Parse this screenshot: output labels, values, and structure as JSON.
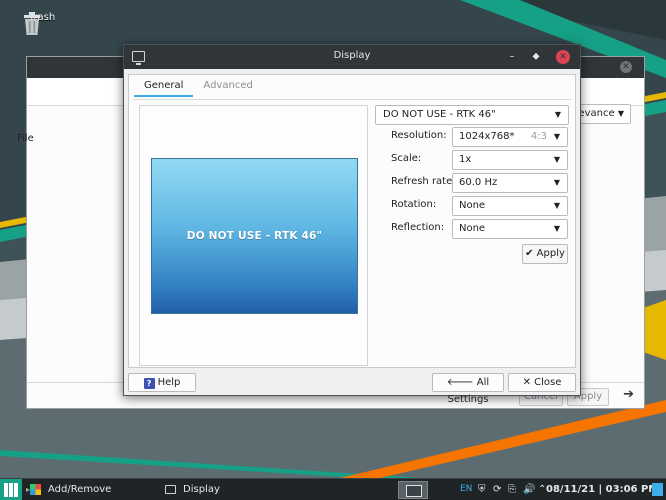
{
  "desktop": {
    "trash_label": "Trash",
    "colors": {
      "teal": "#16a085",
      "orange": "#f67400",
      "yellow": "#e6b800",
      "background": "#2b3a3f"
    }
  },
  "background_window": {
    "side_label": "File",
    "sort": {
      "value": "Relevance",
      "icon": "chevron-down-icon"
    },
    "footer": {
      "cancel_label": "Cancel",
      "apply_label": "Apply",
      "next_icon": "arrow-right-icon"
    }
  },
  "dialog": {
    "title": "Display",
    "app_icon": "monitor-icon",
    "controls": {
      "minimize": "–",
      "maximize": "⬥",
      "close": "✕"
    },
    "tabs": [
      {
        "label": "General",
        "active": true
      },
      {
        "label": "Advanced",
        "active": false
      }
    ],
    "preview": {
      "monitor_label": "DO NOT USE - RTK 46\""
    },
    "output_select": {
      "value": "DO NOT USE - RTK 46\""
    },
    "settings": {
      "resolution": {
        "label": "Resolution:",
        "value": "1024x768*",
        "ratio": "4:3"
      },
      "scale": {
        "label": "Scale:",
        "value": "1x"
      },
      "refresh_rate": {
        "label": "Refresh rate:",
        "value": "60.0 Hz"
      },
      "rotation": {
        "label": "Rotation:",
        "value": "None"
      },
      "reflection": {
        "label": "Reflection:",
        "value": "None"
      }
    },
    "apply_label": "Apply",
    "footer": {
      "help_label": "Help",
      "all_settings_label": "All Settings",
      "close_label": "Close"
    }
  },
  "taskbar": {
    "tasks": [
      {
        "label": "Add/Remove Software",
        "icon": "software-icon"
      },
      {
        "label": "Display",
        "icon": "monitor-icon"
      }
    ],
    "tray": {
      "keyboard_layout": "EN"
    },
    "clock": "08/11/21 | 03:06 PM"
  }
}
